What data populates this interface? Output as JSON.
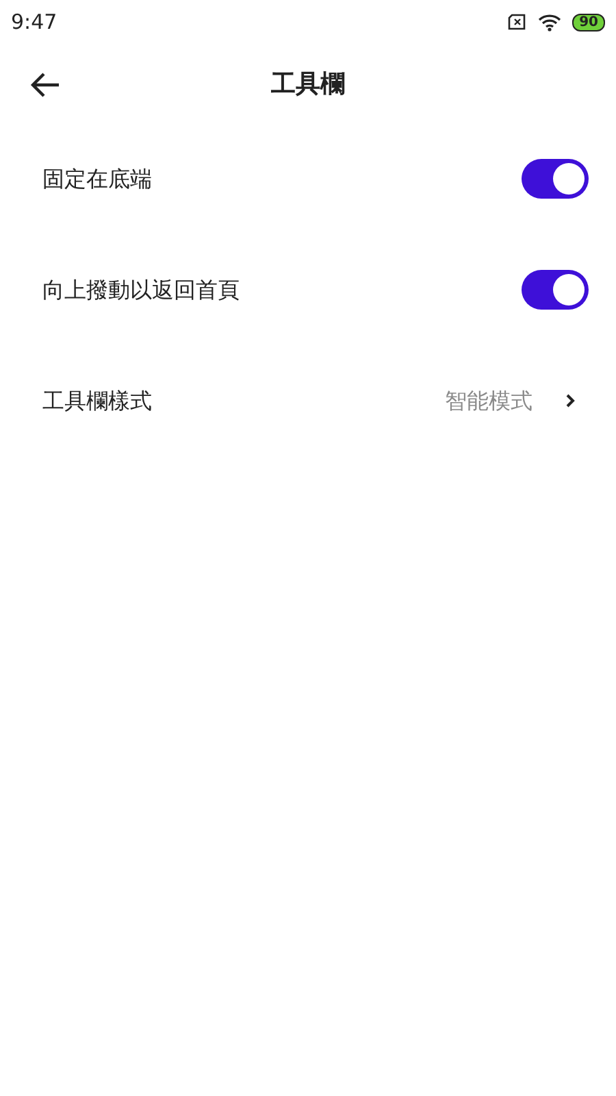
{
  "status_bar": {
    "time": "9:47",
    "battery": "90"
  },
  "header": {
    "title": "工具欄"
  },
  "settings": [
    {
      "kind": "toggle",
      "label": "固定在底端",
      "on": true
    },
    {
      "kind": "toggle",
      "label": "向上撥動以返回首頁",
      "on": true
    },
    {
      "kind": "link",
      "label": "工具欄樣式",
      "value": "智能模式"
    }
  ]
}
